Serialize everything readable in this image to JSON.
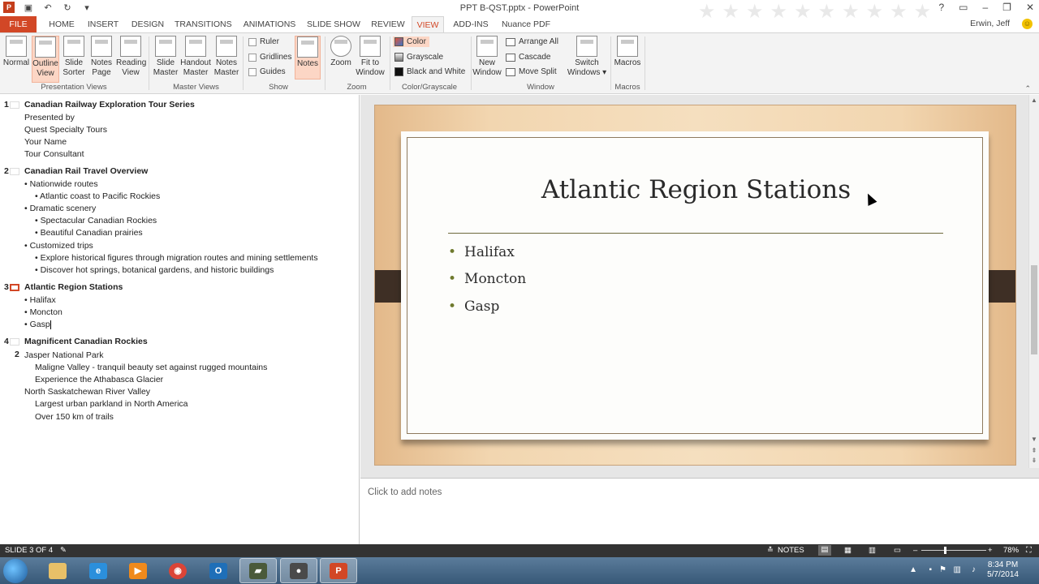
{
  "window": {
    "title": "PPT B-QST.pptx - PowerPoint",
    "user": "Erwin, Jeff"
  },
  "tabs": [
    "FILE",
    "HOME",
    "INSERT",
    "DESIGN",
    "TRANSITIONS",
    "ANIMATIONS",
    "SLIDE SHOW",
    "REVIEW",
    "VIEW",
    "ADD-INS",
    "Nuance PDF"
  ],
  "ribbon": {
    "presentation_views": {
      "label": "Presentation Views",
      "normal": "Normal",
      "outline": [
        "Outline",
        "View"
      ],
      "sorter": [
        "Slide",
        "Sorter"
      ],
      "notes_page": [
        "Notes",
        "Page"
      ],
      "reading": [
        "Reading",
        "View"
      ]
    },
    "master_views": {
      "label": "Master Views",
      "slide": [
        "Slide",
        "Master"
      ],
      "handout": [
        "Handout",
        "Master"
      ],
      "notes": [
        "Notes",
        "Master"
      ]
    },
    "show": {
      "label": "Show",
      "ruler": "Ruler",
      "gridlines": "Gridlines",
      "guides": "Guides",
      "notes": "Notes"
    },
    "zoom": {
      "label": "Zoom",
      "zoom": "Zoom",
      "fit": [
        "Fit to",
        "Window"
      ]
    },
    "color": {
      "label": "Color/Grayscale",
      "color": "Color",
      "grayscale": "Grayscale",
      "bw": "Black and White"
    },
    "window": {
      "label": "Window",
      "new": [
        "New",
        "Window"
      ],
      "arrange": "Arrange All",
      "cascade": "Cascade",
      "move_split": "Move Split",
      "switch": [
        "Switch",
        "Windows ▾"
      ]
    },
    "macros": {
      "label": "Macros",
      "macros": "Macros"
    }
  },
  "outline": {
    "s1": {
      "num": "1",
      "title": "Canadian Railway Exploration Tour Series",
      "lines": [
        "Presented by",
        "Quest Specialty Tours",
        "Your Name",
        "Tour Consultant"
      ]
    },
    "s2": {
      "num": "2",
      "title": "Canadian Rail Travel Overview",
      "lines": [
        "• Nationwide routes",
        "• Atlantic coast to Pacific Rockies",
        "• Dramatic scenery",
        "• Spectacular Canadian Rockies",
        "• Beautiful Canadian prairies",
        "• Customized trips",
        "• Explore historical figures through migration routes and mining settlements",
        "• Discover hot springs, botanical gardens, and historic buildings"
      ]
    },
    "s3": {
      "num": "3",
      "title": "Atlantic Region Stations",
      "lines": [
        "• Halifax",
        "• Moncton",
        "• Gasp"
      ]
    },
    "s4": {
      "num": "4",
      "title": "Magnificent Canadian Rockies",
      "sub_num": "2",
      "lines": [
        "Jasper National Park",
        "Maligne Valley - tranquil beauty set against rugged mountains",
        "Experience the Athabasca Glacier",
        "North Saskatchewan River Valley",
        "Largest urban parkland in North America",
        "Over 150 km of trails"
      ]
    }
  },
  "slide": {
    "title": "Atlantic Region Stations",
    "bullets": [
      "Halifax",
      "Moncton",
      "Gasp"
    ]
  },
  "notes": {
    "placeholder": "Click to add notes"
  },
  "status": {
    "slide": "SLIDE 3 OF 4",
    "notes": "NOTES",
    "zoom": "78%"
  },
  "clock": {
    "time": "8:34 PM",
    "date": "5/7/2014"
  }
}
